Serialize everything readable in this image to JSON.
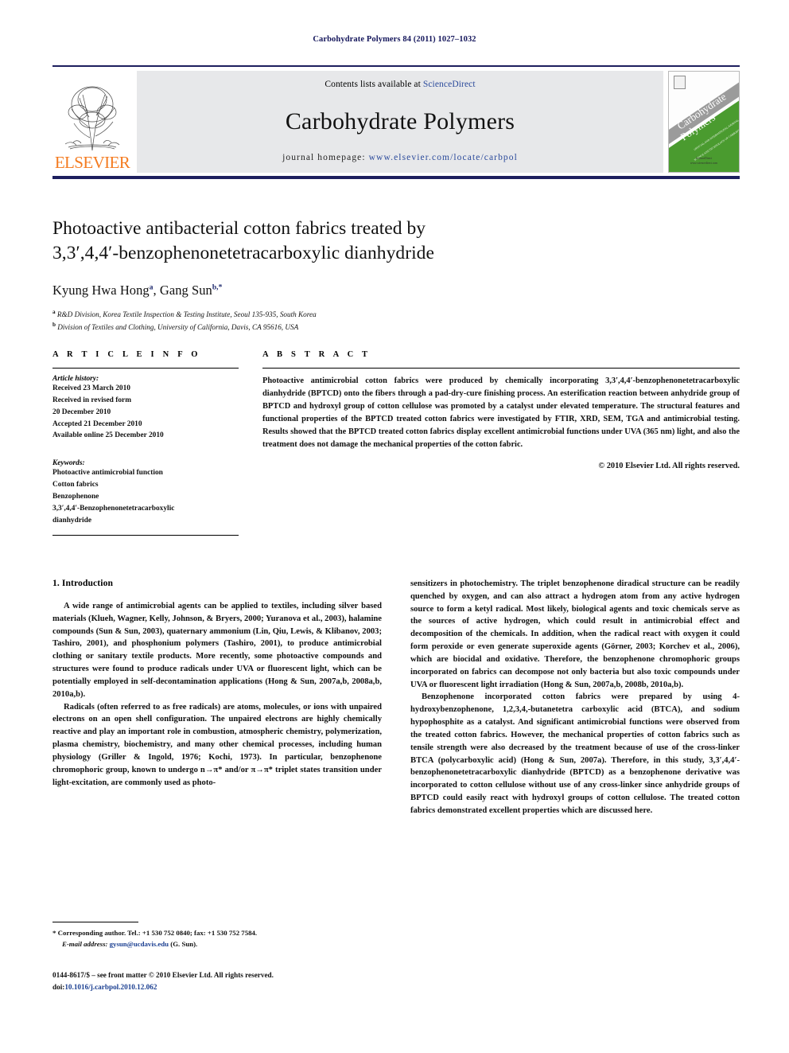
{
  "running_head": "Carbohydrate Polymers 84 (2011) 1027–1032",
  "masthead": {
    "contents_prefix": "Contents lists available at ",
    "contents_link": "ScienceDirect",
    "journal_title": "Carbohydrate Polymers",
    "homepage_prefix": "journal homepage:",
    "homepage_url": "www.elsevier.com/locate/carbpol",
    "publisher": "ELSEVIER",
    "cover_title_line1": "Carbohydrate",
    "cover_title_line2": "Polymers",
    "cover_sub_line1": "OFFICIAL AND INTERNATIONAL JOURNAL OF",
    "cover_sub_line2": "SCIENCE AND TECHNOLOGY OF CARBOHYDRATE POLYMERS",
    "cover_foot_line1": "ScienceDirect",
    "cover_foot_line2": "www.sciencedirect.com"
  },
  "article": {
    "title_line1": "Photoactive antibacterial cotton fabrics treated by",
    "title_line2": "3,3′,4,4′-benzophenonetetracarboxylic dianhydride",
    "author1": "Kyung Hwa Hong",
    "author1_mark": "a",
    "author2": "Gang Sun",
    "author2_mark": "b,*",
    "affiliation_a_mark": "a",
    "affiliation_a": "R&D Division, Korea Textile Inspection & Testing Institute, Seoul 135-935, South Korea",
    "affiliation_b_mark": "b",
    "affiliation_b": "Division of Textiles and Clothing, University of California, Davis, CA 95616, USA"
  },
  "info": {
    "heading": "A R T I C L E   I N F O",
    "history_label": "Article history:",
    "history": [
      "Received 23 March 2010",
      "Received in revised form",
      "20 December 2010",
      "Accepted 21 December 2010",
      "Available online 25 December 2010"
    ],
    "keywords_label": "Keywords:",
    "keywords": [
      "Photoactive antimicrobial function",
      "Cotton fabrics",
      "Benzophenone",
      "3,3′,4,4′-Benzophenonetetracarboxylic",
      "dianhydride"
    ]
  },
  "abstract": {
    "heading": "A B S T R A C T",
    "text": "Photoactive antimicrobial cotton fabrics were produced by chemically incorporating 3,3′,4,4′-benzophenonetetracarboxylic dianhydride (BPTCD) onto the fibers through a pad-dry-cure finishing process. An esterification reaction between anhydride group of BPTCD and hydroxyl group of cotton cellulose was promoted by a catalyst under elevated temperature. The structural features and functional properties of the BPTCD treated cotton fabrics were investigated by FTIR, XRD, SEM, TGA and antimicrobial testing. Results showed that the BPTCD treated cotton fabrics display excellent antimicrobial functions under UVA (365 nm) light, and also the treatment does not damage the mechanical properties of the cotton fabric.",
    "copyright": "© 2010 Elsevier Ltd. All rights reserved."
  },
  "body": {
    "section_number_title": "1.  Introduction",
    "left_paragraphs": [
      "A wide range of antimicrobial agents can be applied to textiles, including silver based materials (Klueh, Wagner, Kelly, Johnson, & Bryers, 2000; Yuranova et al., 2003), halamine compounds (Sun & Sun, 2003), quaternary ammonium (Lin, Qiu, Lewis, & Klibanov, 2003; Tashiro, 2001), and phosphonium polymers (Tashiro, 2001), to produce antimicrobial clothing or sanitary textile products. More recently, some photoactive compounds and structures were found to produce radicals under UVA or fluorescent light, which can be potentially employed in self-decontamination applications (Hong & Sun, 2007a,b, 2008a,b, 2010a,b).",
      "Radicals (often referred to as free radicals) are atoms, molecules, or ions with unpaired electrons on an open shell configuration. The unpaired electrons are highly chemically reactive and play an important role in combustion, atmospheric chemistry, polymerization, plasma chemistry, biochemistry, and many other chemical processes, including human physiology (Griller & Ingold, 1976; Kochi, 1973). In particular, benzophenone chromophoric group, known to undergo n→π* and/or π→π* triplet states transition under light-excitation, are commonly used as photo-"
    ],
    "right_paragraphs": [
      "sensitizers in photochemistry. The triplet benzophenone diradical structure can be readily quenched by oxygen, and can also attract a hydrogen atom from any active hydrogen source to form a ketyl radical. Most likely, biological agents and toxic chemicals serve as the sources of active hydrogen, which could result in antimicrobial effect and decomposition of the chemicals. In addition, when the radical react with oxygen it could form peroxide or even generate superoxide agents (Görner, 2003; Korchev et al., 2006), which are biocidal and oxidative. Therefore, the benzophenone chromophoric groups incorporated on fabrics can decompose not only bacteria but also toxic compounds under UVA or fluorescent light irradiation (Hong & Sun, 2007a,b, 2008b, 2010a,b).",
      "Benzophenone incorporated cotton fabrics were prepared by using 4-hydroxybenzophenone, 1,2,3,4,-butanetetra carboxylic acid (BTCA), and sodium hypophosphite as a catalyst. And significant antimicrobial functions were observed from the treated cotton fabrics. However, the mechanical properties of cotton fabrics such as tensile strength were also decreased by the treatment because of use of the cross-linker BTCA (polycarboxylic acid) (Hong & Sun, 2007a). Therefore, in this study, 3,3′,4,4′-benzophenonetetracarboxylic dianhydride (BPTCD) as a benzophenone derivative was incorporated to cotton cellulose without use of any cross-linker since anhydride groups of BPTCD could easily react with hydroxyl groups of cotton cellulose. The treated cotton fabrics demonstrated excellent properties which are discussed here."
    ]
  },
  "footnotes": {
    "corresponding": "* Corresponding author. Tel.: +1 530 752 0840; fax: +1 530 752 7584.",
    "email_label": "E-mail address:",
    "email": "gysun@ucdavis.edu",
    "email_suffix": "(G. Sun).",
    "issn_line": "0144-8617/$ – see front matter © 2010 Elsevier Ltd. All rights reserved.",
    "doi_prefix": "doi:",
    "doi": "10.1016/j.carbpol.2010.12.062"
  },
  "colors": {
    "rule_navy": "#1d1f5e",
    "link_blue": "#1b3f91",
    "elsevier_orange": "#f47b20",
    "band_gray": "#e7e8ea",
    "cover_green": "#4a9b2f"
  }
}
